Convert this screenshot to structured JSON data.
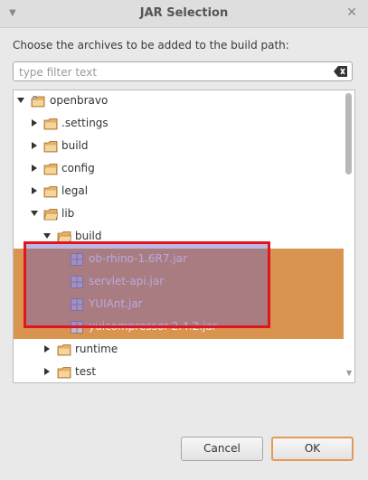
{
  "window": {
    "title": "JAR Selection"
  },
  "instruction": "Choose the archives to be added to the build path:",
  "filter": {
    "placeholder": "type filter text",
    "value": ""
  },
  "tree": {
    "nodes": [
      {
        "label": "openbravo",
        "icon": "project-folder-icon",
        "expanded": true
      },
      {
        "label": ".settings",
        "icon": "folder-icon",
        "expanded": false
      },
      {
        "label": "build",
        "icon": "folder-icon",
        "expanded": false
      },
      {
        "label": "config",
        "icon": "folder-icon",
        "expanded": false
      },
      {
        "label": "legal",
        "icon": "folder-icon",
        "expanded": false
      },
      {
        "label": "lib",
        "icon": "folder-icon",
        "expanded": true
      },
      {
        "label": "build",
        "icon": "folder-icon",
        "expanded": true
      },
      {
        "label": "ob-rhino-1.6R7.jar",
        "icon": "jar-icon",
        "selected": true
      },
      {
        "label": "servlet-api.jar",
        "icon": "jar-icon",
        "selected": true
      },
      {
        "label": "YUIAnt.jar",
        "icon": "jar-icon",
        "selected": true
      },
      {
        "label": "yuicompressor-2.4.2.jar",
        "icon": "jar-icon",
        "selected": true
      },
      {
        "label": "runtime",
        "icon": "folder-icon",
        "expanded": false
      },
      {
        "label": "test",
        "icon": "folder-icon",
        "expanded": false
      }
    ]
  },
  "buttons": {
    "cancel": "Cancel",
    "ok": "OK"
  },
  "colors": {
    "selection": "#d9944f",
    "highlight_border": "#e0151f",
    "ok_border": "#e39a55"
  }
}
